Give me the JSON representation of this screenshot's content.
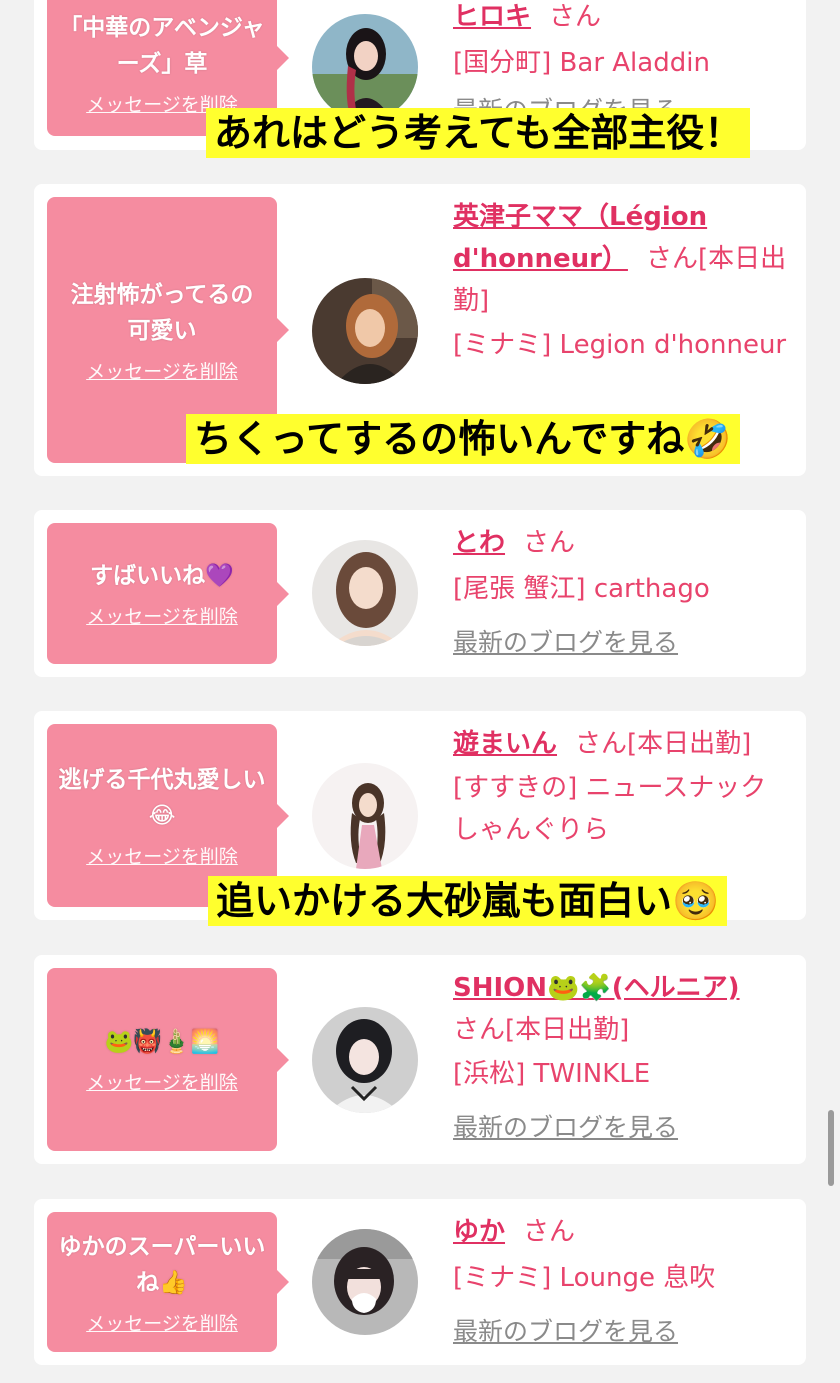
{
  "delete_label": "メッセージを削除",
  "blog_label": "最新のブログを見る",
  "cards": [
    {
      "message": "「中華のアベンジャーズ」草",
      "name": "ヒロキ",
      "san": "さん",
      "shop": "[国分町] Bar Aladdin",
      "blog": "最新のブログを見る",
      "avatar_icon": "woman-portrait"
    },
    {
      "message": "注射怖がってるの可愛い",
      "name": "英津子ママ（Légion d'honneur）",
      "san": "さん[本日出勤]",
      "shop": "[ミナミ] Legion d'honneur",
      "avatar_icon": "woman-portrait"
    },
    {
      "message": "すばいいね💜",
      "name": "とわ",
      "san": "さん",
      "shop": "[尾張 蟹江] carthago",
      "blog": "最新のブログを見る",
      "avatar_icon": "woman-portrait"
    },
    {
      "message": "逃げる千代丸愛しい😂",
      "name": "遊まいん",
      "san": "さん[本日出勤]",
      "shop": "[すすきの] ニュースナック しゃんぐりら",
      "avatar_icon": "woman-portrait"
    },
    {
      "message": "🐸👹🎍🌅",
      "name": "SHION🐸🧩(ヘルニア)",
      "san": "さん[本日出勤]",
      "shop": "[浜松] TWINKLE",
      "blog": "最新のブログを見る",
      "avatar_icon": "woman-portrait"
    },
    {
      "message": "ゆかのスーパーいいね👍",
      "name": "ゆか",
      "san": "さん",
      "shop": "[ミナミ] Lounge 息吹",
      "blog": "最新のブログを見る",
      "avatar_icon": "woman-portrait"
    }
  ],
  "captions": [
    "あれはどう考えても全部主役！",
    "ちくってするの怖いんですね🤣",
    "追いかける大砂嵐も面白い🥹"
  ],
  "colors": {
    "bubble": "#f58ca0",
    "name": "#e03062",
    "caption_bg": "#ffff2e"
  }
}
